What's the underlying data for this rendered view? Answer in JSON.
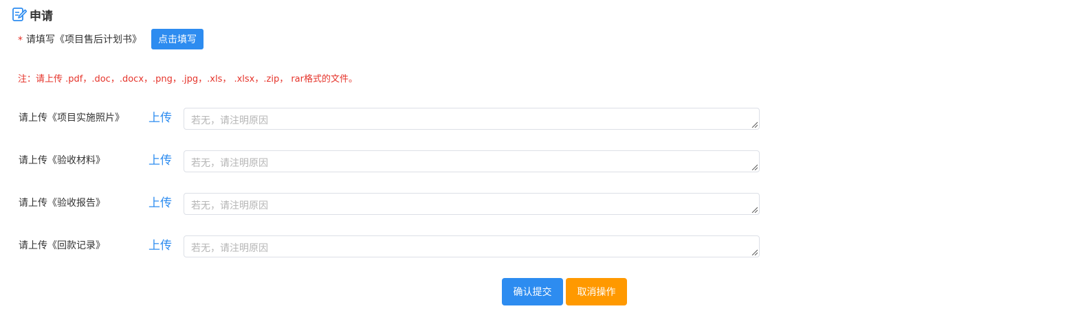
{
  "header": {
    "title": "申请",
    "icon": "edit-document-icon"
  },
  "plan": {
    "required_mark": "*",
    "label": "请填写《项目售后计划书》",
    "fill_button": "点击填写"
  },
  "note": "注：请上传 .pdf，.doc，.docx，.png，.jpg，.xls， .xlsx，.zip， rar格式的文件。",
  "uploads": [
    {
      "label": "请上传《项目实施照片》",
      "link": "上传",
      "placeholder": "若无，请注明原因"
    },
    {
      "label": "请上传《验收材料》",
      "link": "上传",
      "placeholder": "若无，请注明原因"
    },
    {
      "label": "请上传《验收报告》",
      "link": "上传",
      "placeholder": "若无，请注明原因"
    },
    {
      "label": "请上传《回款记录》",
      "link": "上传",
      "placeholder": "若无，请注明原因"
    }
  ],
  "actions": {
    "confirm": "确认提交",
    "cancel": "取消操作"
  },
  "colors": {
    "primary": "#2d8cf0",
    "warning": "#ff9900",
    "danger": "#e5332a"
  }
}
